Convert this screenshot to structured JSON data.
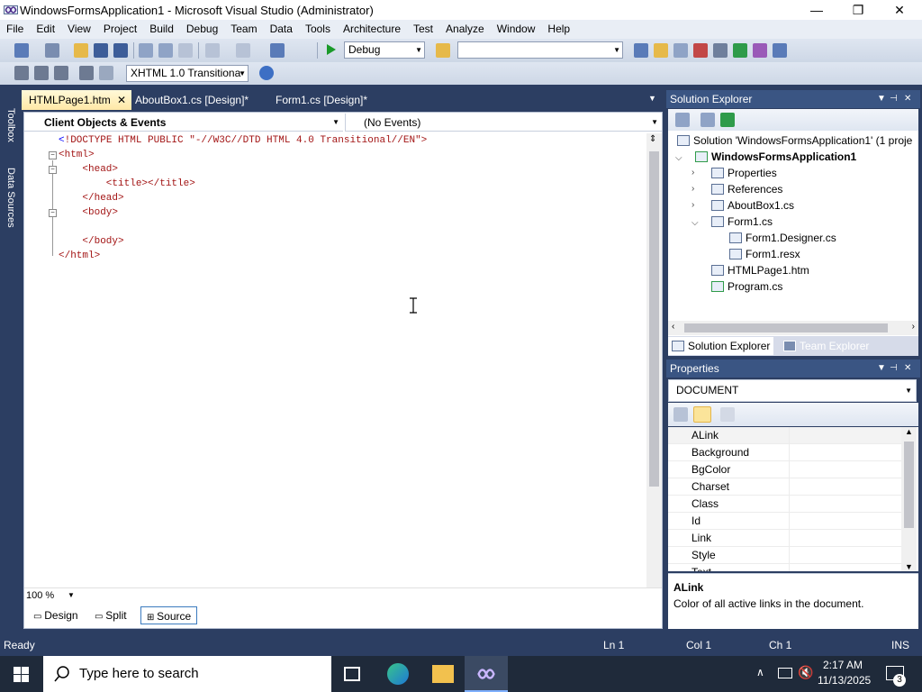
{
  "window": {
    "title": "WindowsFormsApplication1 - Microsoft Visual Studio (Administrator)",
    "minimize": "—",
    "maximize": "❐",
    "close": "✕"
  },
  "menu": [
    "File",
    "Edit",
    "View",
    "Project",
    "Build",
    "Debug",
    "Team",
    "Data",
    "Tools",
    "Architecture",
    "Test",
    "Analyze",
    "Window",
    "Help"
  ],
  "toolbar": {
    "config": "Debug",
    "platform": "",
    "doctype": "XHTML 1.0 Transitiona"
  },
  "left_rail": {
    "toolbox": "Toolbox",
    "data_sources": "Data Sources"
  },
  "doc_tabs": [
    {
      "label": "HTMLPage1.htm",
      "active": true
    },
    {
      "label": "AboutBox1.cs [Design]*",
      "active": false
    },
    {
      "label": "Form1.cs [Design]*",
      "active": false
    }
  ],
  "editor": {
    "objects_combo": "Client Objects & Events",
    "events_combo": "(No Events)",
    "lines": [
      "<!DOCTYPE HTML PUBLIC \"-//W3C//DTD HTML 4.0 Transitional//EN\">",
      "<html>",
      "    <head>",
      "        <title></title>",
      "    </head>",
      "    <body>",
      "",
      "    </body>",
      "</html>"
    ],
    "zoom": "100 %",
    "view_tabs": [
      "Design",
      "Split",
      "Source"
    ],
    "active_view": "Source"
  },
  "solution_explorer": {
    "title": "Solution Explorer",
    "items": [
      {
        "label": "Solution 'WindowsFormsApplication1' (1 proje",
        "level": 0,
        "expander": ""
      },
      {
        "label": "WindowsFormsApplication1",
        "level": 1,
        "expander": "expanded",
        "bold": true
      },
      {
        "label": "Properties",
        "level": 2,
        "expander": "collapsed"
      },
      {
        "label": "References",
        "level": 2,
        "expander": "collapsed"
      },
      {
        "label": "AboutBox1.cs",
        "level": 2,
        "expander": "collapsed"
      },
      {
        "label": "Form1.cs",
        "level": 2,
        "expander": "expanded"
      },
      {
        "label": "Form1.Designer.cs",
        "level": 3,
        "expander": ""
      },
      {
        "label": "Form1.resx",
        "level": 3,
        "expander": ""
      },
      {
        "label": "HTMLPage1.htm",
        "level": 2,
        "expander": ""
      },
      {
        "label": "Program.cs",
        "level": 2,
        "expander": ""
      }
    ],
    "tabs": [
      "Solution Explorer",
      "Team Explorer"
    ]
  },
  "properties": {
    "title": "Properties",
    "object": "DOCUMENT",
    "rows": [
      "ALink",
      "Background",
      "BgColor",
      "Charset",
      "Class",
      "Id",
      "Link",
      "Style",
      "Text"
    ],
    "selected": "ALink",
    "desc_title": "ALink",
    "desc_text": "Color of all active links in the document."
  },
  "status": {
    "state": "Ready",
    "ln": "Ln 1",
    "col": "Col 1",
    "ch": "Ch 1",
    "mode": "INS"
  },
  "taskbar": {
    "search_placeholder": "Type here to search",
    "time": "2:17 AM",
    "date": "11/13/2025",
    "notifications": "3"
  },
  "colors": {
    "chrome": "#2c3e62",
    "panel_title": "#3a5583",
    "active_tab": "#ffe8a6"
  }
}
